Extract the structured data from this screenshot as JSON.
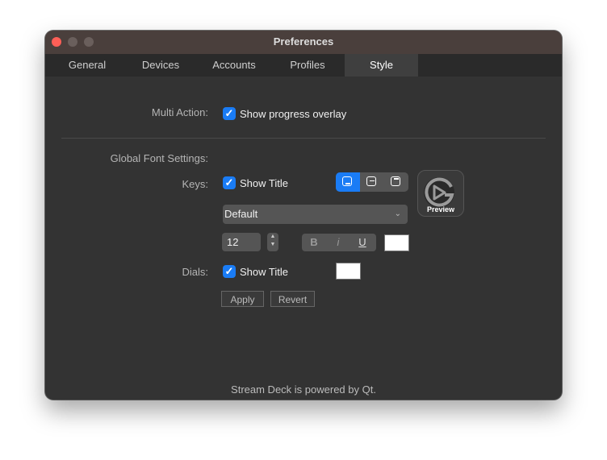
{
  "window": {
    "title": "Preferences"
  },
  "tabs": [
    {
      "label": "General"
    },
    {
      "label": "Devices"
    },
    {
      "label": "Accounts"
    },
    {
      "label": "Profiles"
    },
    {
      "label": "Style",
      "active": true
    }
  ],
  "multi_action": {
    "label": "Multi Action:",
    "checkbox_label": "Show progress overlay",
    "checked": true
  },
  "global_font": {
    "label": "Global Font Settings:"
  },
  "keys": {
    "label": "Keys:",
    "checkbox_label": "Show Title",
    "checked": true,
    "alignment_options": [
      "bottom-align-icon",
      "middle-align-icon",
      "top-align-icon"
    ],
    "selected_alignment": "bottom",
    "font": "Default",
    "size": "12",
    "style_buttons": {
      "bold": "B",
      "italic": "i",
      "underline": "U"
    },
    "color": "#ffffff",
    "preview_label": "Preview"
  },
  "dials": {
    "label": "Dials:",
    "checkbox_label": "Show Title",
    "checked": true,
    "color": "#ffffff"
  },
  "buttons": {
    "apply": "Apply",
    "revert": "Revert"
  },
  "footer": "Stream Deck is powered by Qt.",
  "colors": {
    "accent": "#1a7cf5",
    "background": "#333333",
    "titlebar": "#4a3f3c"
  }
}
